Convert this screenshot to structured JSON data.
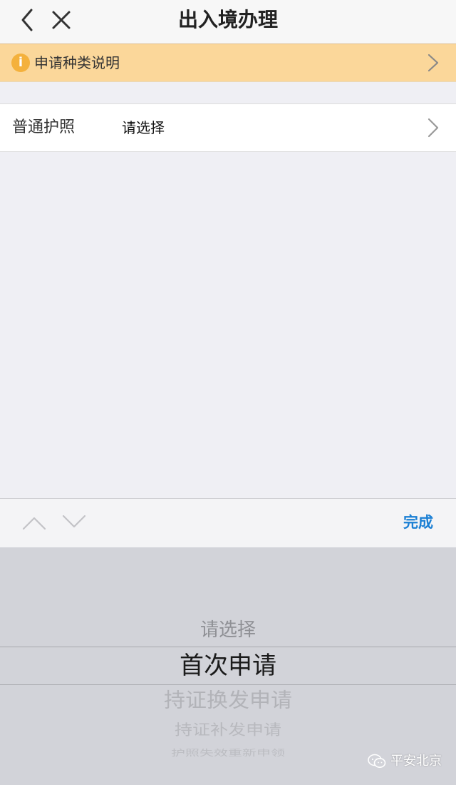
{
  "navbar": {
    "title": "出入境办理",
    "back_icon": "chevron-left-icon",
    "close_icon": "close-icon"
  },
  "notice": {
    "text": "申请种类说明",
    "icon": "info-icon",
    "icon_glyph": "i",
    "icon_color": "#f4b13c",
    "background": "#fbd79a"
  },
  "form": {
    "rows": [
      {
        "label": "普通护照",
        "value": "请选择"
      }
    ]
  },
  "toolbar": {
    "done_label": "完成",
    "done_color": "#1a7fd4"
  },
  "picker": {
    "options": [
      "请选择",
      "首次申请",
      "持证换发申请",
      "持证补发申请",
      "护照失效重新申领"
    ],
    "selected": "首次申请"
  },
  "watermark": {
    "text": "平安北京",
    "icon": "wechat-icon"
  }
}
